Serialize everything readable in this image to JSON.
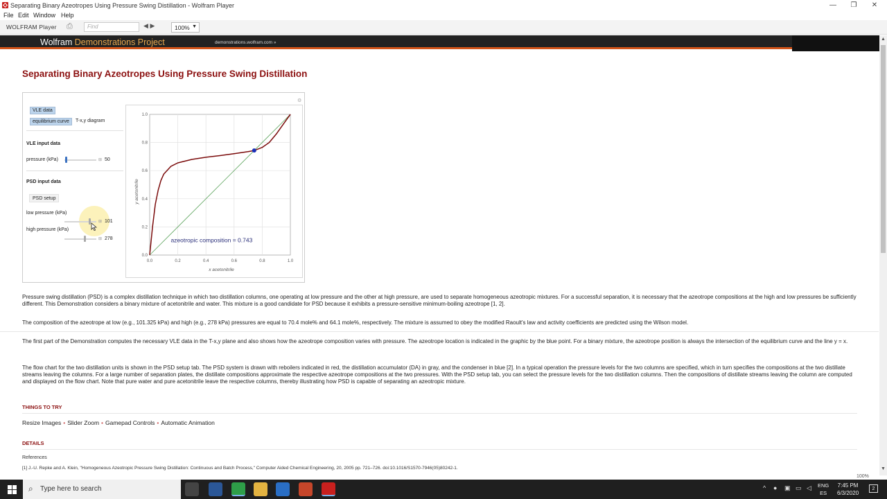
{
  "window": {
    "title": "Separating Binary Azeotropes Using Pressure Swing Distillation - Wolfram Player",
    "controls": [
      "—",
      "❐",
      "✕"
    ]
  },
  "menu": [
    "File",
    "Edit",
    "Window",
    "Help"
  ],
  "toolbar": {
    "brand": "WOLFRAM Player",
    "find_placeholder": "Find",
    "zoom": "100%"
  },
  "header": {
    "wordmark_a": "Wolfram ",
    "wordmark_b": "Demonstrations Project",
    "site": "demonstrations.wolfram.com »"
  },
  "page_title": "Separating Binary Azeotropes Using Pressure Swing Distillation",
  "panel": {
    "tabs_row1": [
      "VLE data"
    ],
    "tabs_row2": [
      "equilibrium curve",
      "T-x,y diagram"
    ],
    "vle_section": "VLE input data",
    "pressure_label": "pressure (kPa)",
    "pressure_value": "50",
    "pressure_fraction": 0.05,
    "psd_section": "PSD input data",
    "psd_setup": "PSD setup",
    "low_label": "low pressure (kPa)",
    "low_value": "101",
    "low_fraction": 0.8,
    "high_label": "high pressure (kPa)",
    "high_value": "278",
    "high_fraction": 0.64
  },
  "chart_data": {
    "type": "line",
    "xlabel": "x acetonitrile",
    "ylabel": "y acetonitrile",
    "xlim": [
      0,
      1
    ],
    "ylim": [
      0,
      1
    ],
    "xticks": [
      "0.0",
      "0.2",
      "0.4",
      "0.6",
      "0.8",
      "1.0"
    ],
    "yticks": [
      "0.0",
      "0.2",
      "0.4",
      "0.6",
      "0.8",
      "1.0"
    ],
    "grid": true,
    "annotation": "azeotropic composition = 0.743",
    "azeotrope_point": {
      "x": 0.743,
      "y": 0.743
    },
    "series": [
      {
        "color": "#7a0a0a",
        "x": [
          0,
          0.02,
          0.04,
          0.06,
          0.08,
          0.1,
          0.15,
          0.2,
          0.3,
          0.4,
          0.5,
          0.6,
          0.7,
          0.743,
          0.8,
          0.85,
          0.9,
          0.95,
          1.0
        ],
        "y": [
          0,
          0.2,
          0.36,
          0.46,
          0.53,
          0.575,
          0.63,
          0.655,
          0.68,
          0.695,
          0.707,
          0.72,
          0.735,
          0.743,
          0.765,
          0.8,
          0.86,
          0.93,
          1.0
        ]
      },
      {
        "color": "#5fa55f",
        "x": [
          0,
          1
        ],
        "y": [
          0,
          1
        ]
      }
    ]
  },
  "paragraphs": [
    "Pressure swing distillation (PSD) is a complex distillation technique in which two distillation columns, one operating at low pressure and the other at high pressure, are used to separate homogeneous azeotropic mixtures. For a successful separation, it is necessary that the azeotrope compositions at the high and low pressures be sufficiently different. This Demonstration considers a binary mixture of acetonitrile and water. This mixture is a good candidate for PSD because it exhibits a pressure-sensitive minimum-boiling azeotrope [1, 2].",
    "The composition of the azeotrope at low (e.g., 101.325 kPa) and high (e.g., 278 kPa) pressures are equal to 70.4 mole% and 64.1 mole%, respectively. The mixture is assumed to obey the modified Raoult's law and activity coefficients are predicted using the Wilson model.",
    "The first part of the Demonstration computes the necessary VLE data in the T-x,y plane and also shows how the azeotrope composition varies with pressure. The azeotrope location is indicated in the graphic by the blue point. For a binary mixture, the azeotrope position is always the intersection of the equilibrium curve and the line y = x.",
    "The flow chart for the two distillation units is shown in the PSD setup tab. The PSD system is drawn with reboilers indicated in red, the distillation accumulator (DA) in gray, and the condenser in blue [2]. In a typical operation the pressure levels for the two columns are specified, which in turn specifies the compositions at the two distillate streams leaving the columns. For a large number of separation plates, the distillate compositions approximate the respective azeotrope compositions at the two pressures. With the PSD setup tab, you can select the pressure levels for the two distillation columns. Then the compositions of distillate streams leaving the column are computed and displayed on the flow chart. Note that pure water and pure acetonitrile leave the respective columns, thereby illustrating how PSD is capable of separating an azeotropic mixture."
  ],
  "things_to_try": {
    "heading": "THINGS TO TRY",
    "items": [
      "Resize Images",
      "Slider Zoom",
      "Gamepad Controls",
      "Automatic Animation"
    ]
  },
  "details": {
    "heading": "DETAILS",
    "refs_label": "References",
    "ref1": "[1] J.-U. Repke and A. Klein, \"Homogeneous Azeotropic Pressure Swing Distillation: Continuous and Batch Process,\" Computer Aided Chemical Engineering, 20, 2005 pp. 721–726. doi:10.1016/S1570-7946(05)80242-1."
  },
  "status_zoom": "100%",
  "taskbar": {
    "search_placeholder": "Type here to search",
    "lang_top": "ENG",
    "lang_bottom": "ES",
    "time": "7:45 PM",
    "date": "6/3/2020",
    "notif": "2",
    "apps": [
      {
        "name": "task-view",
        "color": "#444444"
      },
      {
        "name": "app-blue",
        "color": "#2b5797"
      },
      {
        "name": "chrome",
        "color": "#2e9e48"
      },
      {
        "name": "file-explorer",
        "color": "#e3b341"
      },
      {
        "name": "cortana",
        "color": "#2a6ec4"
      },
      {
        "name": "powerpoint",
        "color": "#c6462a"
      },
      {
        "name": "wolfram-player",
        "color": "#c8201e"
      }
    ]
  }
}
